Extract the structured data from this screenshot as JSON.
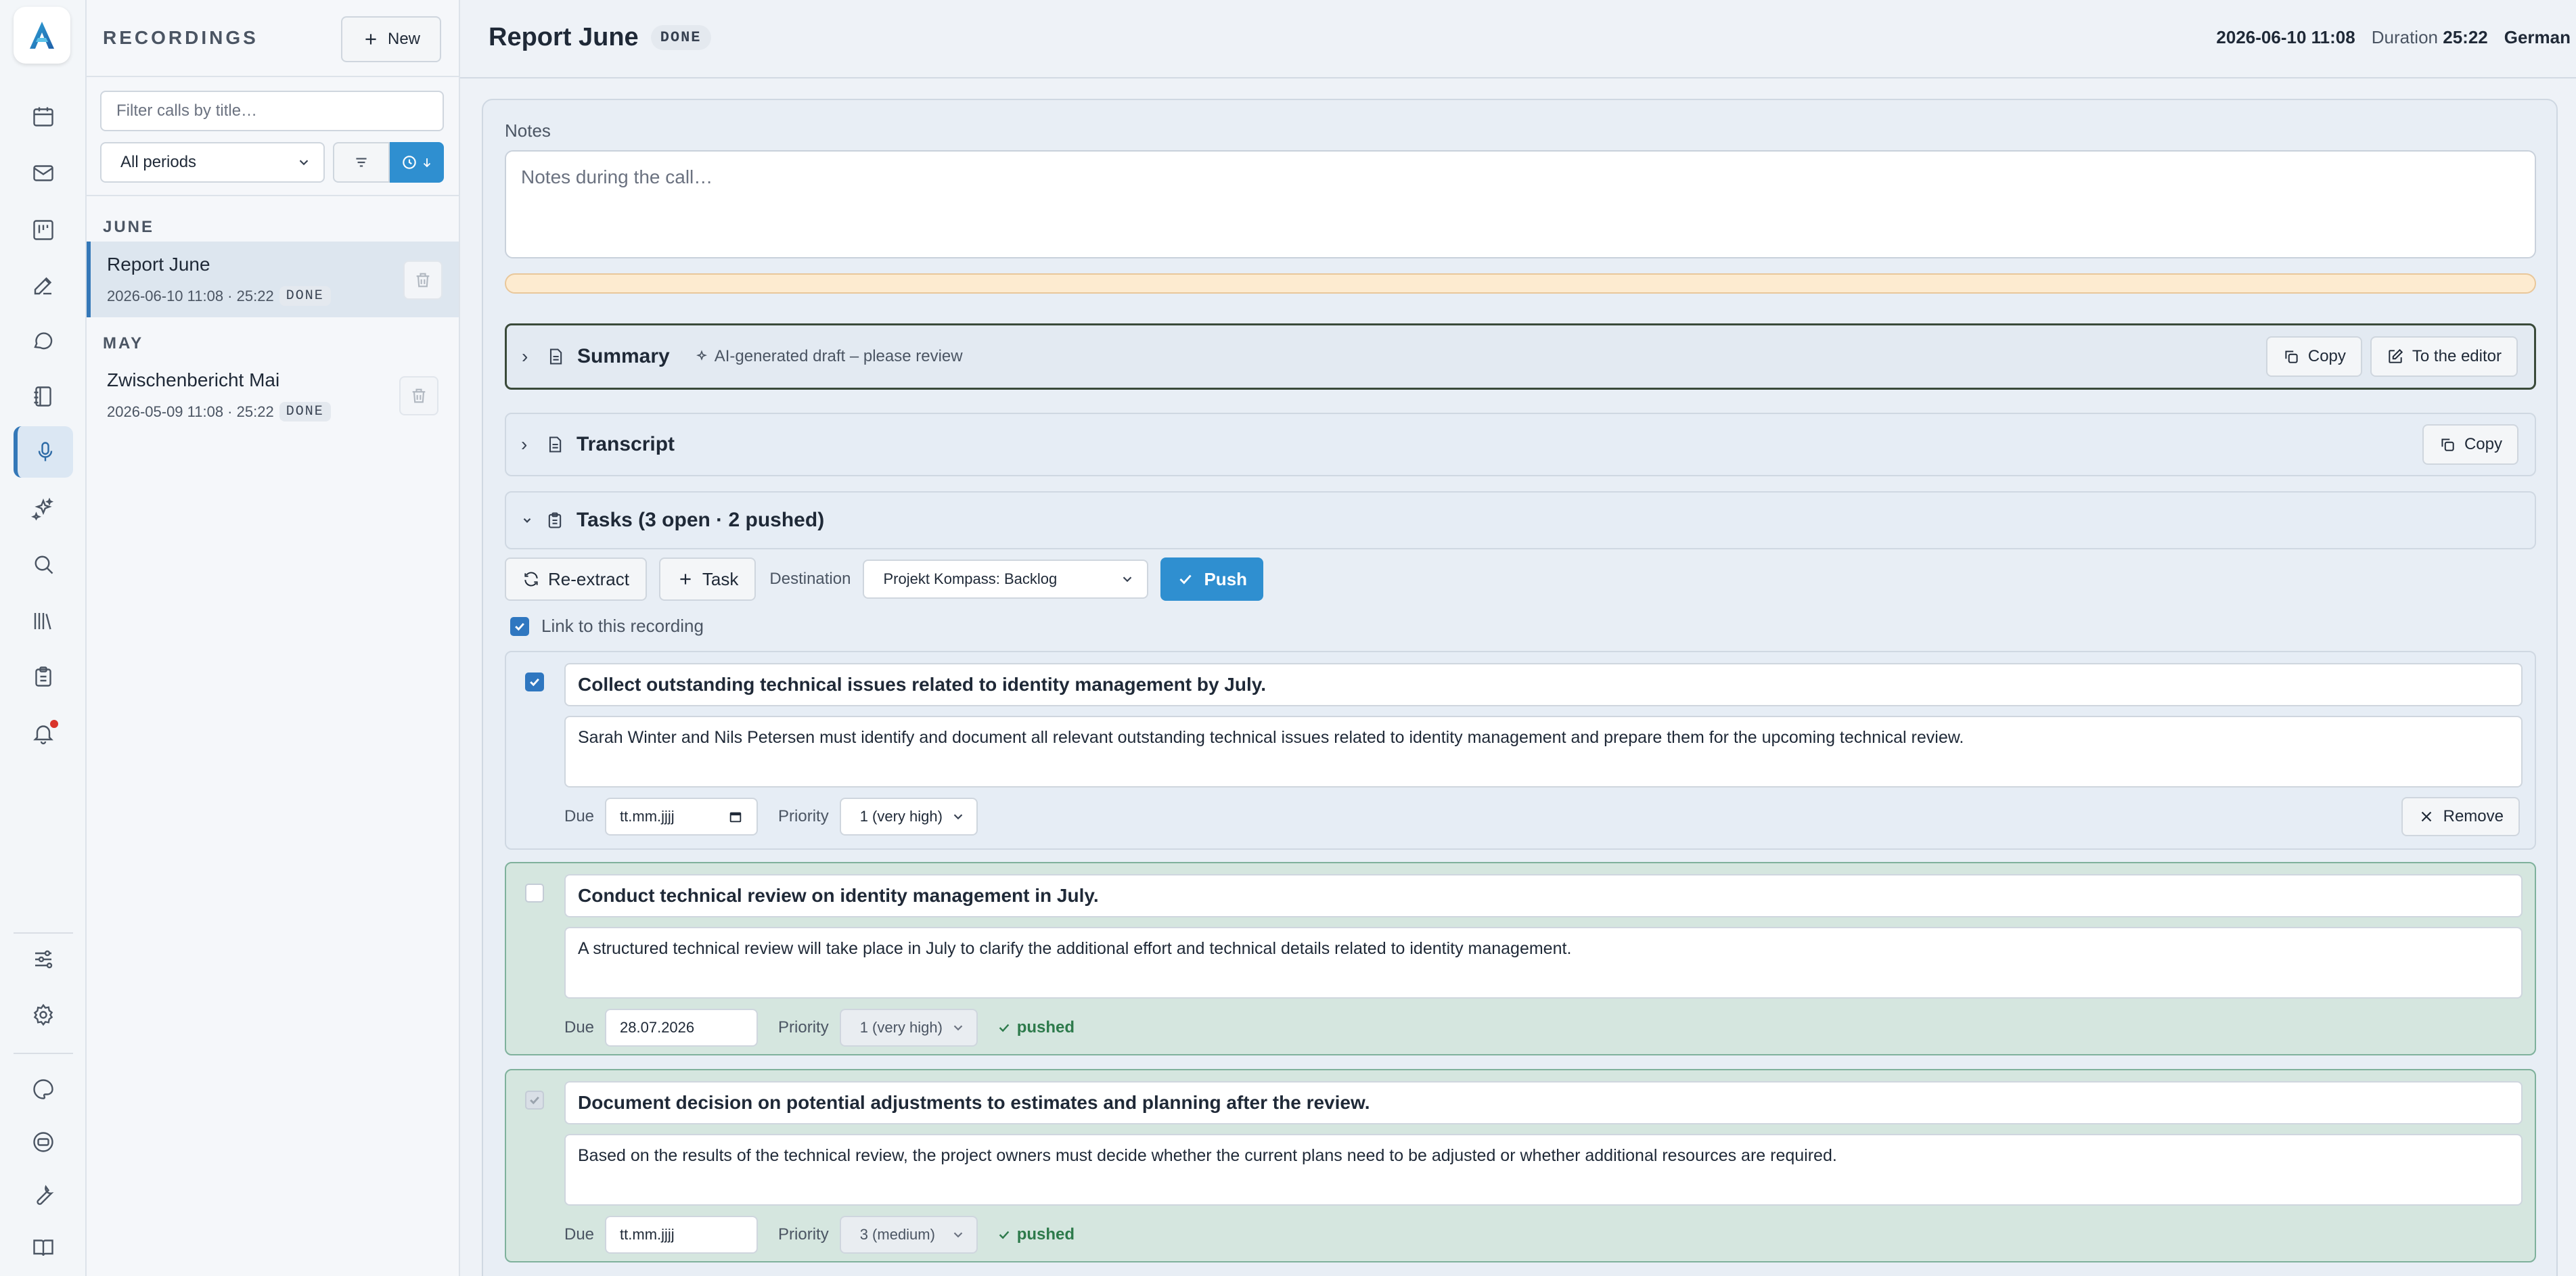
{
  "colors": {
    "accent": "#2f8fd0",
    "active_rail": "#3478b8",
    "pushed_bg": "#d5e6df",
    "pushed_text": "#2d7a4b",
    "notification_dot": "#d9342b"
  },
  "rail": {
    "logo": "app-logo",
    "icons": [
      "calendar-icon",
      "mail-icon",
      "board-icon",
      "edit-icon",
      "chat-icon",
      "notebook-icon",
      "microphone-icon",
      "sparkles-icon",
      "search-icon",
      "library-icon",
      "clipboard-icon",
      "bell-icon",
      "sliders-icon",
      "settings-icon",
      "palette-icon",
      "badge-icon",
      "wrench-icon",
      "book-icon"
    ],
    "active": "microphone-icon"
  },
  "recordings": {
    "title": "RECORDINGS",
    "new_label": "New",
    "filter_placeholder": "Filter calls by title…",
    "period_value": "All periods",
    "groups": [
      {
        "label": "JUNE",
        "items": [
          {
            "title": "Report June",
            "meta": "2026-06-10 11:08 · 25:22",
            "status": "DONE"
          }
        ]
      },
      {
        "label": "MAY",
        "items": [
          {
            "title": "Zwischenbericht Mai",
            "meta": "2026-05-09 11:08 · 25:22",
            "status": "DONE"
          }
        ]
      }
    ]
  },
  "header": {
    "title": "Report June",
    "status": "DONE",
    "datetime": "2026-06-10 11:08",
    "duration_label": "Duration",
    "duration": "25:22",
    "language": "German"
  },
  "notes": {
    "label": "Notes",
    "placeholder": "Notes during the call…"
  },
  "summary": {
    "title": "Summary",
    "hint": "AI-generated draft – please review",
    "copy_label": "Copy",
    "editor_label": "To the editor"
  },
  "transcript": {
    "title": "Transcript",
    "copy_label": "Copy"
  },
  "tasks": {
    "title": "Tasks (3 open · 2 pushed)",
    "reextract_label": "Re-extract",
    "add_task_label": "Task",
    "destination_label": "Destination",
    "destination_value": "Projekt Kompass: Backlog",
    "push_label": "Push",
    "link_label": "Link to this recording",
    "link_checked": true,
    "due_label": "Due",
    "priority_label": "Priority",
    "remove_label": "Remove",
    "pushed_label": "pushed",
    "items": [
      {
        "title": "Collect outstanding technical issues related to identity management by July.",
        "description": "Sarah Winter and Nils Petersen must identify and document all relevant outstanding technical issues related to identity management and prepare them for the upcoming technical review.",
        "due": "tt.mm.jjjj",
        "priority": "1 (very high)",
        "checked": true,
        "pushed": false
      },
      {
        "title": "Conduct technical review on identity management in July.",
        "description": "A structured technical review will take place in July to clarify the additional effort and technical details related to identity management.",
        "due": "28.07.2026",
        "priority": "1 (very high)",
        "checked": false,
        "pushed": true
      },
      {
        "title": "Document decision on potential adjustments to estimates and planning after the review.",
        "description": "Based on the results of the technical review, the project owners must decide whether the current plans need to be adjusted or whether additional resources are required.",
        "due": "tt.mm.jjjj",
        "priority": "3 (medium)",
        "checked": true,
        "pushed": true
      }
    ]
  }
}
